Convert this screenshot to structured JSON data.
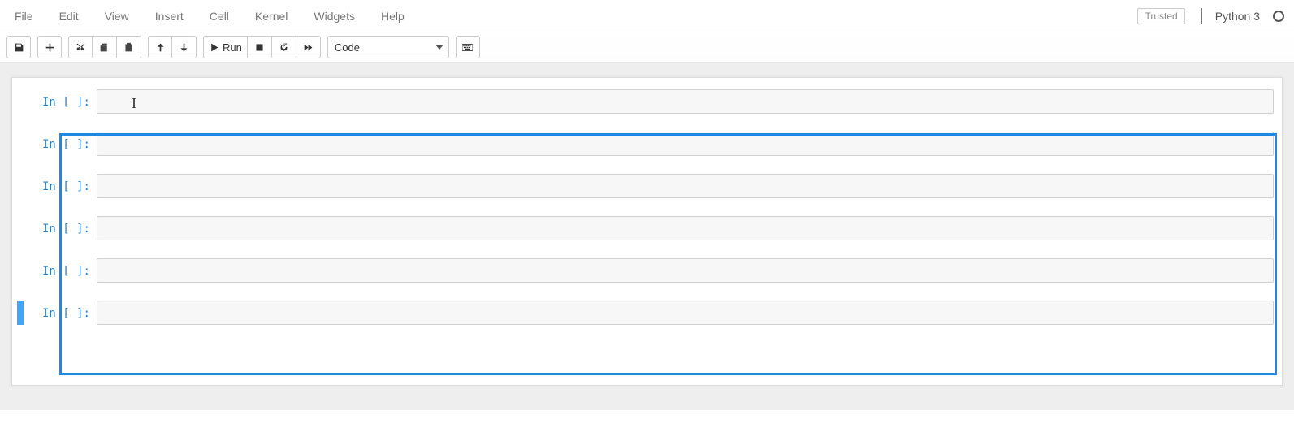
{
  "menubar": {
    "items": [
      "File",
      "Edit",
      "View",
      "Insert",
      "Cell",
      "Kernel",
      "Widgets",
      "Help"
    ],
    "trusted_label": "Trusted",
    "kernel_name": "Python 3"
  },
  "toolbar": {
    "run_label": "Run",
    "cell_type_selected": "Code"
  },
  "cells": [
    {
      "prompt": "In [ ]:",
      "content": ""
    },
    {
      "prompt": "In [ ]:",
      "content": ""
    },
    {
      "prompt": "In [ ]:",
      "content": ""
    },
    {
      "prompt": "In [ ]:",
      "content": ""
    },
    {
      "prompt": "In [ ]:",
      "content": ""
    },
    {
      "prompt": "In [ ]:",
      "content": ""
    }
  ],
  "selection": {
    "highlight_box": true,
    "selected_cell_index": 5
  }
}
